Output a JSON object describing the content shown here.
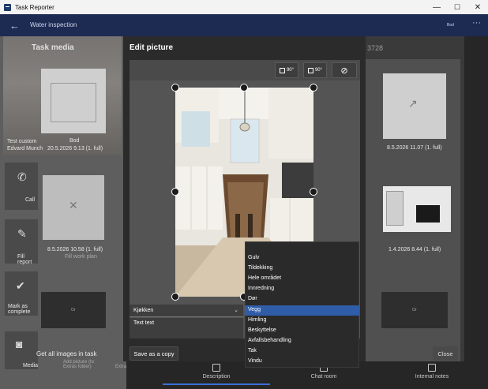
{
  "window": {
    "title": "Task Reporter",
    "minimize": "—",
    "maximize": "☐",
    "close": "✕"
  },
  "header": {
    "title": "Water inspection",
    "right_label": "Bod",
    "more": "···"
  },
  "background": {
    "panel_title": "Task media",
    "customer_line1": "Test custom",
    "customer_line2": "Edvard Munch",
    "tile1_caption": "Bod",
    "tile1_date": "20.5.2026 9.13 (1. full)",
    "tile2_date": "8.5.2026 10.58 (1. full)",
    "right_id": "3728",
    "right_tile1_date": "8.5.2026 11.07 (1. full)",
    "right_tile2_date": "1.4.2026 8.44 (1. full)",
    "left_items": [
      {
        "label": "Call"
      },
      {
        "label": "Fill report"
      },
      {
        "label": "Mark as complete"
      },
      {
        "label": "Media"
      }
    ],
    "get_all_images": "Get all images in task",
    "add_picture": "Add picture (to Extras folder)",
    "add_picture_short": "Extras folder)",
    "fill_work_plan": "Fill work plan",
    "dark_tile_label": "Or"
  },
  "modal": {
    "title": "Edit picture",
    "rotate_left_label": "90°",
    "rotate_right_label": "90°",
    "selected_value": "Kjøkken",
    "text_value": "Text text",
    "save_copy": "Save as a copy",
    "close": "Close"
  },
  "menu": {
    "items": [
      "Gulv",
      "Tildekking",
      "Hele området",
      "Innredning",
      "Dør",
      "Vegg",
      "Himling",
      "Beskyttelse",
      "Avfallsbehandling",
      "Tak",
      "Vindu"
    ],
    "selected": "Vegg"
  },
  "bottom_nav": {
    "description": "Description",
    "chat_room": "Chat room",
    "internal_notes": "Internal notes"
  },
  "colors": {
    "header": "#1d2a52",
    "selection": "#2f5da8",
    "accent_tab": "#3a6fd8"
  }
}
